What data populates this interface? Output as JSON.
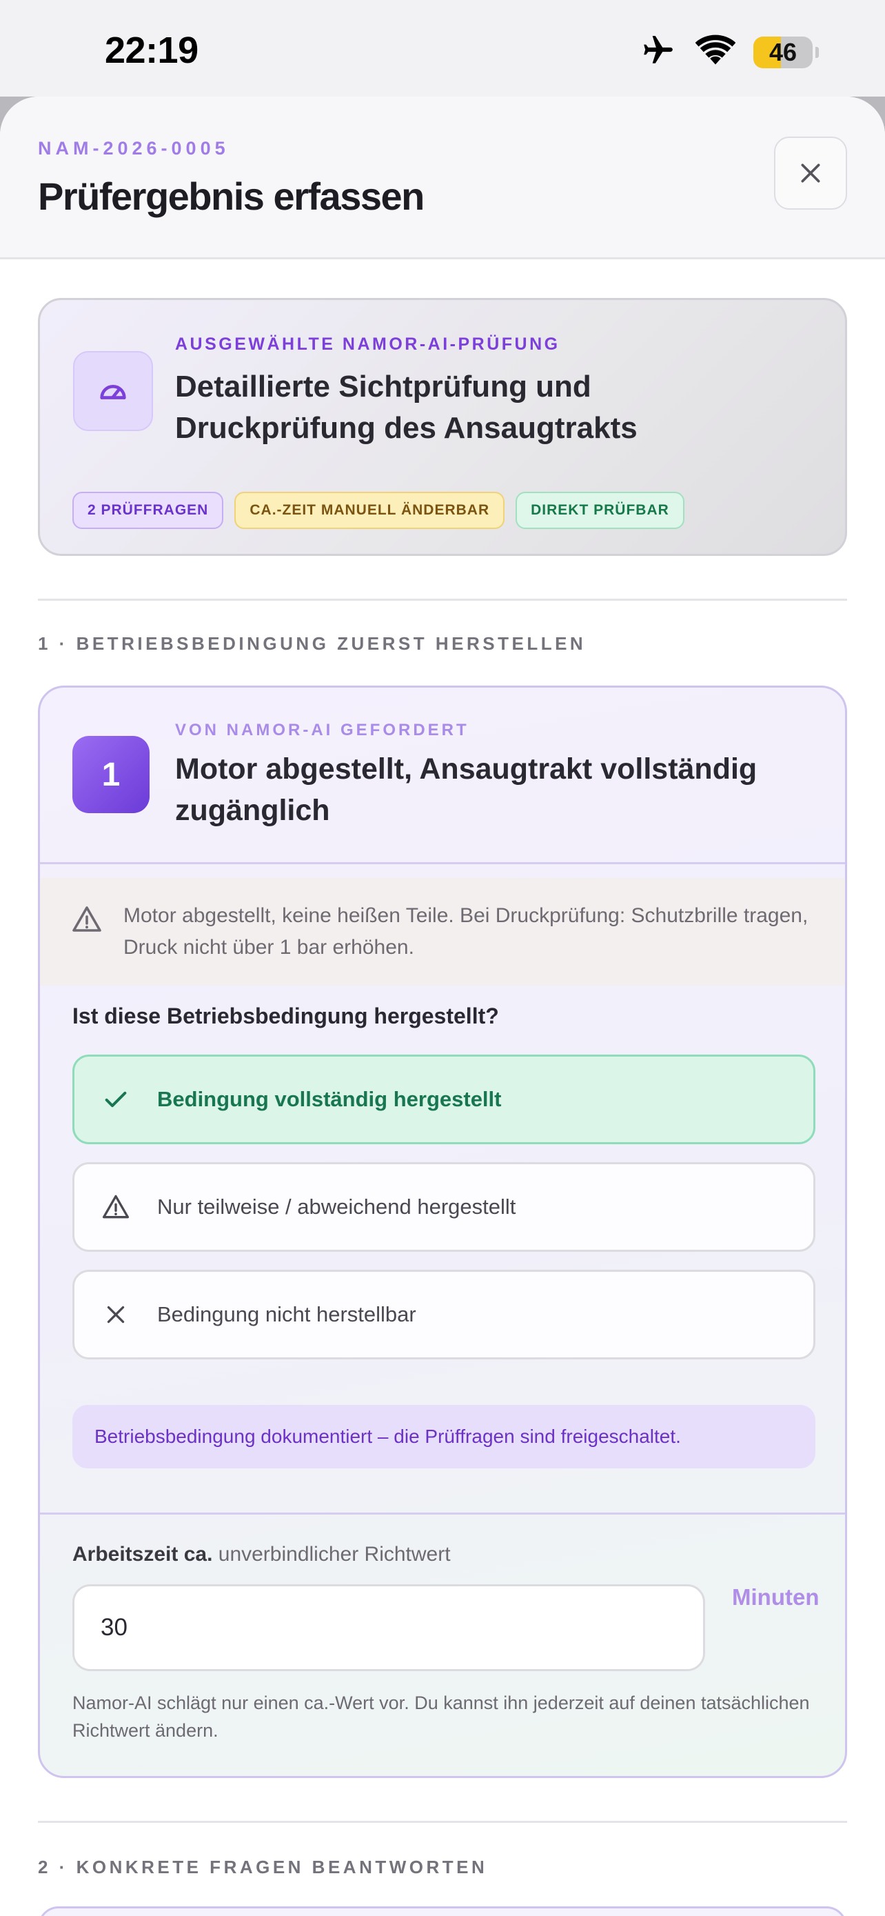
{
  "status_bar": {
    "time": "22:19",
    "battery": "46",
    "battery_level": 0.46
  },
  "header": {
    "case_id": "NAM-2026-0005",
    "title": "Prüfergebnis erfassen"
  },
  "selected_check": {
    "kicker": "AUSGEWÄHLTE NAMOR-AI-PRÜFUNG",
    "title": "Detaillierte Sichtprüfung und Druckprüfung des Ansaugtrakts",
    "chips": [
      "2 PRÜFFRAGEN",
      "CA.-ZEIT MANUELL ÄNDERBAR",
      "DIREKT PRÜFBAR"
    ]
  },
  "section1": {
    "label": "1 · BETRIEBSBEDINGUNG ZUERST HERSTELLEN"
  },
  "condition": {
    "number": "1",
    "kicker": "VON NAMOR-AI GEFORDERT",
    "title": "Motor abgestellt, Ansaugtrakt vollständig zugänglich",
    "warning": "Motor abgestellt, keine heißen Teile. Bei Druckprüfung: Schutzbrille tragen, Druck nicht über 1 bar erhöhen.",
    "question": "Ist diese Betriebsbedingung hergestellt?",
    "options": [
      {
        "label": "Bedingung vollständig hergestellt",
        "icon": "check-icon",
        "selected": true
      },
      {
        "label": "Nur teilweise / abweichend hergestellt",
        "icon": "warning-icon",
        "selected": false
      },
      {
        "label": "Bedingung nicht herstellbar",
        "icon": "close-icon",
        "selected": false
      }
    ],
    "unlock_note": "Betriebsbedingung dokumentiert – die Prüffragen sind freigeschaltet."
  },
  "work_time": {
    "label_bold": "Arbeitszeit ca.",
    "label_rest": " unverbindlicher Richtwert",
    "value": "30",
    "unit": "Minuten",
    "hint": "Namor-AI schlägt nur einen ca.-Wert vor. Du kannst ihn jederzeit auf deinen tatsächlichen Richtwert ändern."
  },
  "section2": {
    "label": "2 · KONKRETE FRAGEN BEANTWORTEN"
  },
  "colors": {
    "accent": "#7c3fd9",
    "success": "#187750",
    "warning_bg": "#fdefb9"
  }
}
